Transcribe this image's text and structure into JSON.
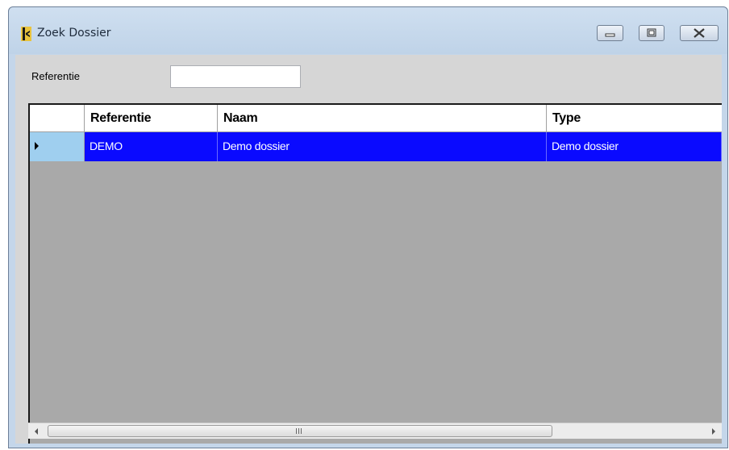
{
  "window": {
    "title": "Zoek Dossier",
    "icon": "app-logo-icon",
    "controls": [
      "minimize-icon",
      "maximize-icon",
      "close-icon"
    ]
  },
  "filter": {
    "label": "Referentie",
    "value": ""
  },
  "grid": {
    "columns": [
      "Referentie",
      "Naam",
      "Type"
    ],
    "rows": [
      {
        "referentie": "DEMO",
        "naam": "Demo dossier",
        "type": "Demo dossier",
        "selected": true
      }
    ]
  },
  "colors": {
    "selection": "#0a0aff",
    "grid_background": "#a9a9a9",
    "title_bar": "#c4d6ea"
  }
}
